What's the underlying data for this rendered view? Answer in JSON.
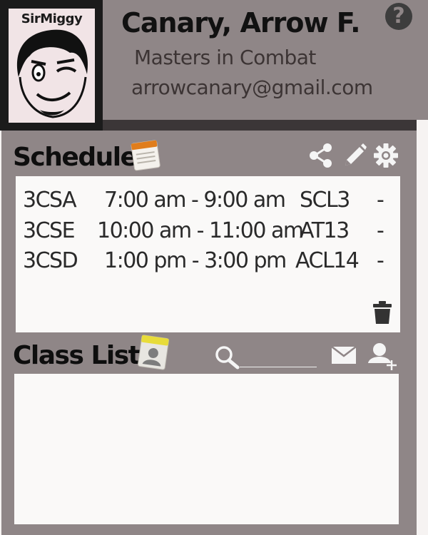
{
  "profile": {
    "brand": "SirMiggy",
    "name": "Canary, Arrow F.",
    "degree": "Masters in Combat",
    "email": "arrowcanary@gmail.com",
    "help_symbol": "?"
  },
  "schedule": {
    "title": "Schedule",
    "rows": [
      {
        "section": "3CSA",
        "time": "7:00 am - 9:00 am",
        "room": "SCL3",
        "extra": "-"
      },
      {
        "section": "3CSE",
        "time": "10:00 am - 11:00 am",
        "room": "AT13",
        "extra": "-"
      },
      {
        "section": "3CSD",
        "time": "1:00 pm - 3:00 pm",
        "room": "ACL14",
        "extra": "-"
      }
    ]
  },
  "class_list": {
    "title": "Class List",
    "search_value": ""
  },
  "icons": {
    "help": "help-icon",
    "schedule_notepad": "notepad-icon",
    "share": "share-icon",
    "edit": "pencil-icon",
    "settings": "gear-icon",
    "delete": "trash-icon",
    "class_list": "id-card-icon",
    "search": "search-icon",
    "mail": "mail-icon",
    "add_user": "add-user-icon"
  },
  "colors": {
    "background": "#8f8687",
    "panel": "#faf9f8",
    "dark": "#1b1b1b",
    "icon_light": "#f5f5f5",
    "icon_dark": "#333333"
  }
}
